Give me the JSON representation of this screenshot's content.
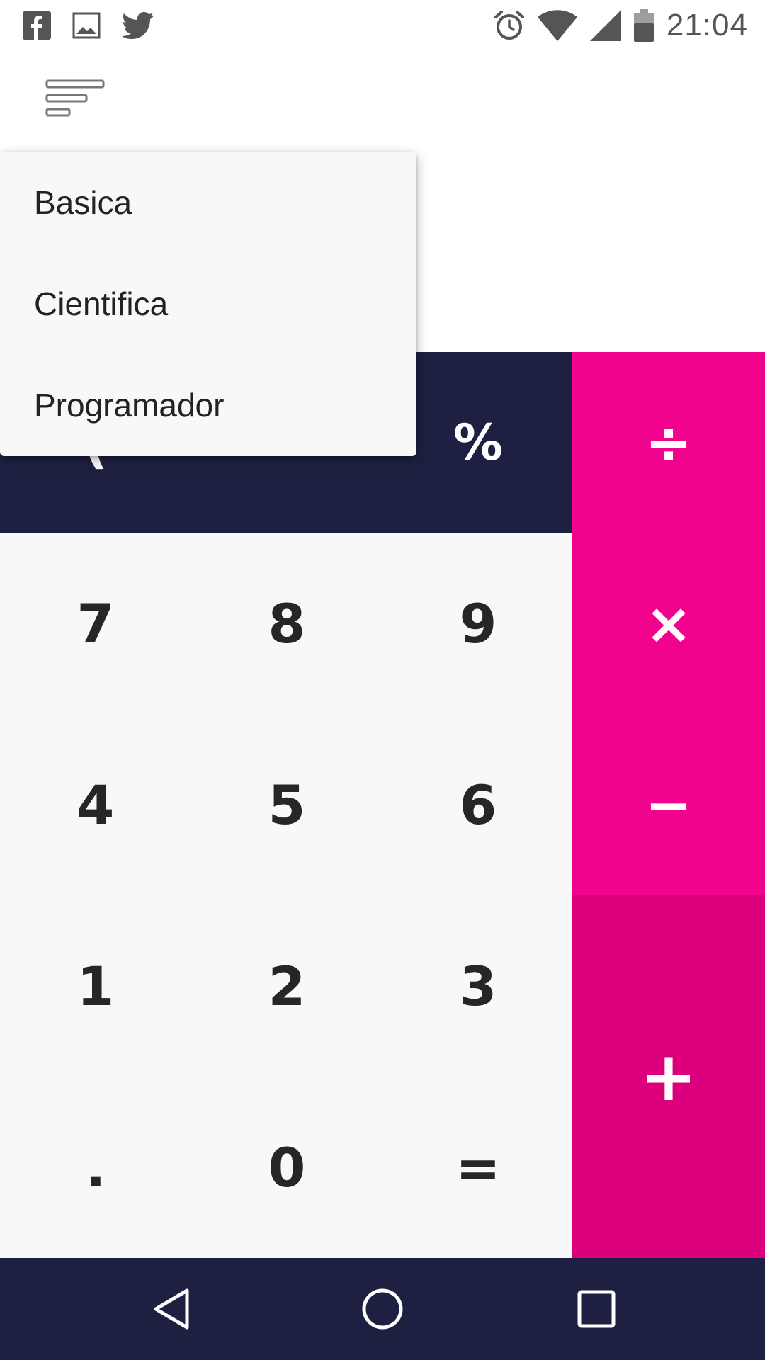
{
  "status_bar": {
    "left_icons": [
      "facebook-icon",
      "image-icon",
      "twitter-icon"
    ],
    "right_icons": [
      "alarm-icon",
      "wifi-icon",
      "signal-icon",
      "battery-icon"
    ],
    "time": "21:04"
  },
  "toolbar": {
    "menu_icon": "sort-lines-icon"
  },
  "dropdown": {
    "items": [
      "Basica",
      "Cientifica",
      "Programador"
    ]
  },
  "keypad": {
    "top_row": {
      "partial_key": "(",
      "percent": "%"
    },
    "digits": {
      "seven": "7",
      "eight": "8",
      "nine": "9",
      "four": "4",
      "five": "5",
      "six": "6",
      "one": "1",
      "two": "2",
      "three": "3",
      "dot": ".",
      "zero": "0",
      "equals": "="
    },
    "operators": {
      "divide": "÷",
      "multiply": "×",
      "minus": "−",
      "plus": "+"
    }
  },
  "nav_bar": {
    "icons": [
      "back-icon",
      "home-icon",
      "recents-icon"
    ]
  },
  "colors": {
    "navy": "#1e2042",
    "pink": "#f0048e",
    "pink_dark": "#dc007d",
    "key_panel": "#f8f8f8",
    "menu_bg": "#f8f8f8"
  }
}
